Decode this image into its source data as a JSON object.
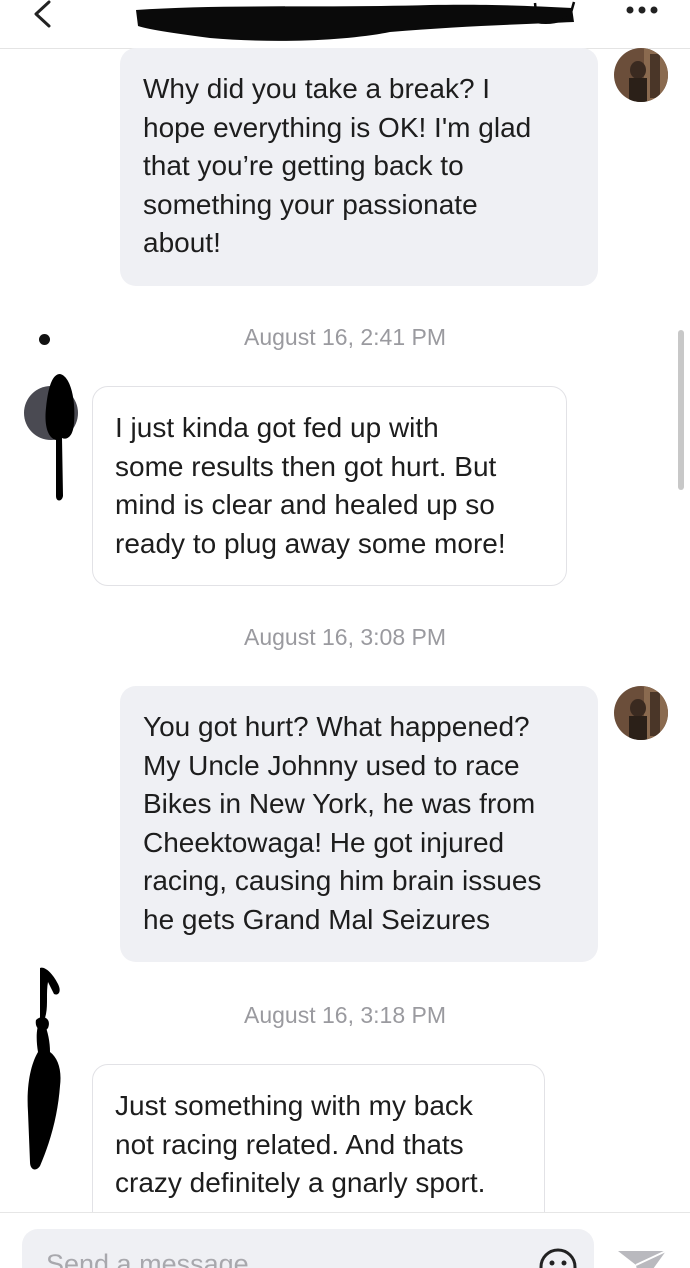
{
  "header": {
    "back_icon": "chevron-left-icon",
    "more_icon": "ellipsis-icon",
    "name_redacted": true
  },
  "messages": [
    {
      "direction": "sent",
      "text": "Why did you take a break? I\nhope everything is OK!  I'm glad\nthat you’re getting back to\nsomething your passionate\nabout!"
    },
    {
      "direction": "received",
      "timestamp": "August 16, 2:41 PM",
      "text": "I just kinda got fed up with\nsome results then got hurt. But\nmind is clear and healed up so\nready to plug away some more!"
    },
    {
      "direction": "sent",
      "timestamp": "August 16, 3:08 PM",
      "text": "You got hurt? What happened?\nMy Uncle Johnny used to race\nBikes in New York, he was from\nCheektowaga! He got injured\nracing, causing him brain issues\nhe gets Grand Mal Seizures"
    },
    {
      "direction": "received",
      "timestamp": "August 16, 3:18 PM",
      "text": "Just something with my back\nnot racing related. And thats\ncrazy definitely a gnarly sport."
    }
  ],
  "composer": {
    "placeholder": "Send a message",
    "emoji_icon": "emoji-icon",
    "send_icon": "send-icon"
  },
  "colors": {
    "sent_bubble": "#eff0f4",
    "received_bubble": "#ffffff",
    "timestamp": "#9a9a9f",
    "send_icon": "#b9b9be"
  }
}
